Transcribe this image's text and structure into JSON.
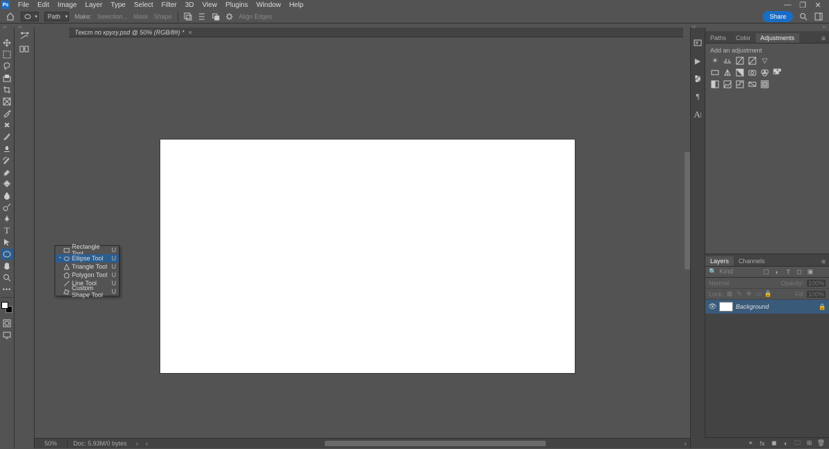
{
  "menu": {
    "items": [
      "File",
      "Edit",
      "Image",
      "Layer",
      "Type",
      "Select",
      "Filter",
      "3D",
      "View",
      "Plugins",
      "Window",
      "Help"
    ]
  },
  "options": {
    "mode_label": "Path",
    "make_label": "Make:",
    "selection": "Selection...",
    "mask": "Mask",
    "shape": "Shape",
    "align_edges": "Align Edges",
    "share": "Share"
  },
  "doc": {
    "tab_title": "Текст по кругу.psd @ 50% (RGB/8#) *",
    "zoom": "50%",
    "info": "Doc: 5.93M/0 bytes"
  },
  "flyout": {
    "items": [
      {
        "label": "Rectangle Tool",
        "key": "U",
        "icon": "rect"
      },
      {
        "label": "Ellipse Tool",
        "key": "U",
        "icon": "ellipse",
        "selected": true
      },
      {
        "label": "Triangle Tool",
        "key": "U",
        "icon": "triangle"
      },
      {
        "label": "Polygon Tool",
        "key": "U",
        "icon": "polygon"
      },
      {
        "label": "Line Tool",
        "key": "U",
        "icon": "line"
      },
      {
        "label": "Custom Shape Tool",
        "key": "U",
        "icon": "custom"
      }
    ]
  },
  "right_panels": {
    "top_tabs": [
      "Paths",
      "Color",
      "Adjustments"
    ],
    "top_active": 2,
    "adj_title": "Add an adjustment",
    "layers_tabs": [
      "Layers",
      "Channels"
    ],
    "layers_active": 0,
    "kind_label": "Kind",
    "blend_mode": "Normal",
    "opacity_label": "Opacity:",
    "opacity_val": "100%",
    "lock_label": "Lock:",
    "fill_label": "Fill:",
    "fill_val": "100%",
    "layer_name": "Background"
  },
  "search_placeholder": "Kind"
}
